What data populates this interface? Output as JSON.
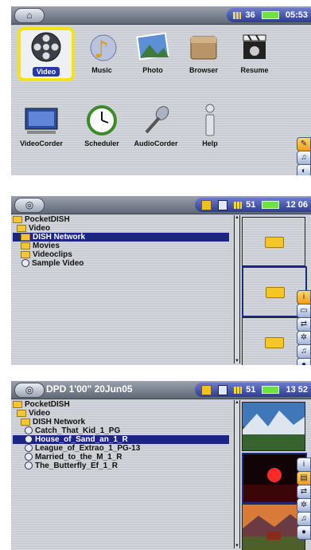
{
  "screen1": {
    "status": {
      "volume": "36",
      "time": "05:53"
    },
    "apps": [
      {
        "label": "Video",
        "icon": "film-reel-icon"
      },
      {
        "label": "Music",
        "icon": "music-note-icon"
      },
      {
        "label": "Photo",
        "icon": "photo-icon"
      },
      {
        "label": "Browser",
        "icon": "folder-icon"
      },
      {
        "label": "Resume",
        "icon": "clapperboard-icon"
      },
      {
        "label": "VideoCorder",
        "icon": "tv-icon"
      },
      {
        "label": "Scheduler",
        "icon": "clock-icon"
      },
      {
        "label": "AudioCorder",
        "icon": "microphone-icon"
      },
      {
        "label": "Help",
        "icon": "info-icon"
      }
    ]
  },
  "screen2": {
    "status": {
      "volume": "51",
      "time": "12 06"
    },
    "tree": [
      {
        "label": "PocketDISH",
        "type": "folder",
        "indent": 0
      },
      {
        "label": "Video",
        "type": "folder",
        "indent": 1
      },
      {
        "label": "DISH Network",
        "type": "folder",
        "indent": 2,
        "highlight": true
      },
      {
        "label": "Movies",
        "type": "folder",
        "indent": 2
      },
      {
        "label": "Videoclips",
        "type": "folder",
        "indent": 2
      },
      {
        "label": "Sample Video",
        "type": "video",
        "indent": 2
      }
    ]
  },
  "screen3": {
    "header": "DPD 1'00\" 20Jun05",
    "status": {
      "volume": "51",
      "time": "13 52"
    },
    "tree": [
      {
        "label": "PocketDISH",
        "type": "folder",
        "indent": 0
      },
      {
        "label": "Video",
        "type": "folder",
        "indent": 1
      },
      {
        "label": "DISH Network",
        "type": "folder",
        "indent": 2
      },
      {
        "label": "Catch_That_Kid_1_PG",
        "type": "video",
        "indent": 3
      },
      {
        "label": "House_of_Sand_an_1_R",
        "type": "video",
        "indent": 3,
        "highlight": true
      },
      {
        "label": "League_of_Extrao_1_PG-13",
        "type": "video",
        "indent": 3
      },
      {
        "label": "Married_to_the_M_1_R",
        "type": "video",
        "indent": 3
      },
      {
        "label": "The_Butterfly_Ef_1_R",
        "type": "video",
        "indent": 3
      }
    ]
  }
}
